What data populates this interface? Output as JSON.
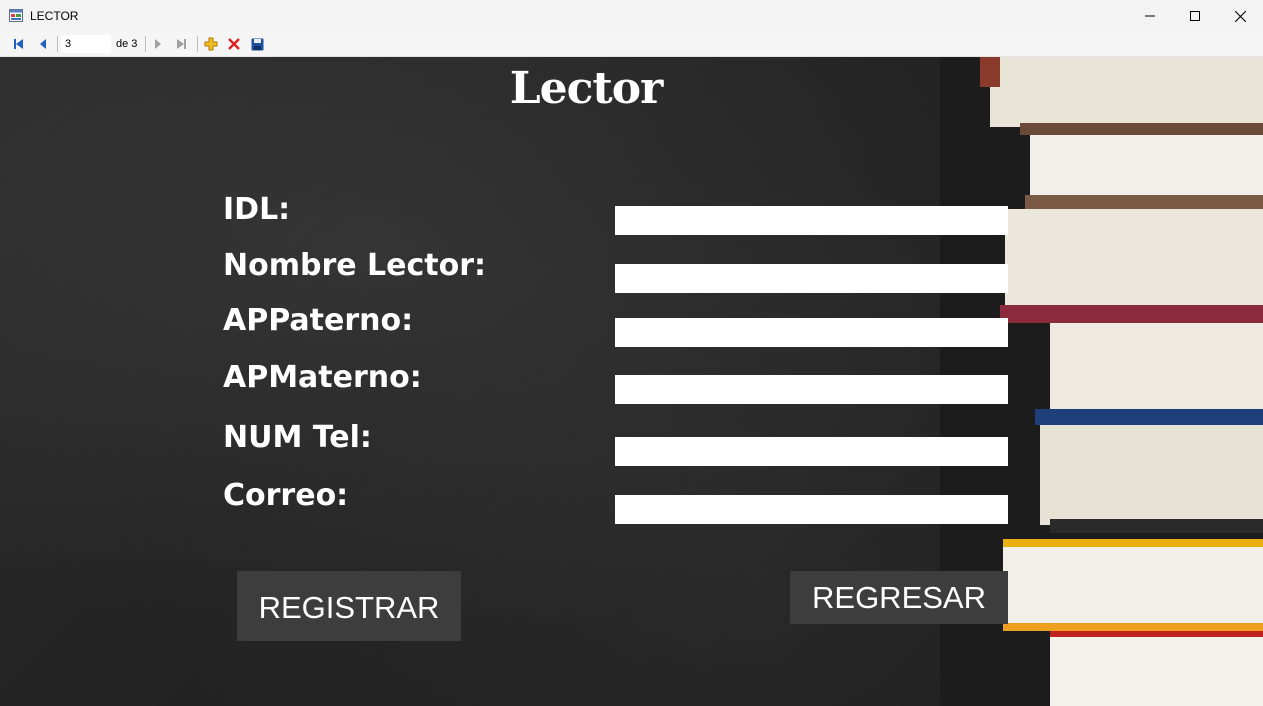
{
  "window": {
    "title": "LECTOR",
    "controls": [
      "minimize",
      "maximize",
      "close"
    ]
  },
  "navigator": {
    "position": "3",
    "count_label": "de 3",
    "buttons": [
      "move-first",
      "move-previous",
      "move-next",
      "move-last",
      "add-new",
      "delete",
      "save"
    ]
  },
  "form": {
    "title": "Lector",
    "fields": [
      {
        "label": "IDL:",
        "value": ""
      },
      {
        "label": "Nombre Lector:",
        "value": ""
      },
      {
        "label": "APPaterno:",
        "value": ""
      },
      {
        "label": "APMaterno:",
        "value": ""
      },
      {
        "label": "NUM Tel:",
        "value": ""
      },
      {
        "label": "Correo:",
        "value": ""
      }
    ],
    "register_label": "REGISTRAR",
    "back_label": "REGRESAR"
  },
  "colors": {
    "background": "#232323",
    "button": "#3d3d3d",
    "text": "#ffffff",
    "nav_arrow": "#1e5fbf",
    "add_icon": "#e8b010",
    "delete_icon": "#e02020",
    "save_icon": "#1e4f9a"
  }
}
